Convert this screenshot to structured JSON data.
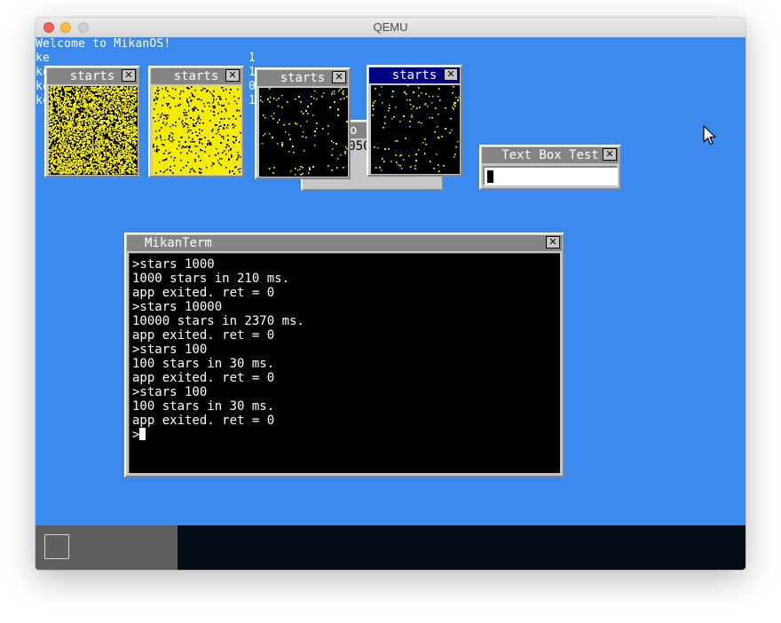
{
  "app": {
    "title": "QEMU"
  },
  "console": {
    "line1": "Welcome to MikanOS!",
    "lines": [
      "ke",
      "ke",
      "ke",
      "ke"
    ],
    "right_digits": [
      "1",
      "1",
      "0",
      "1"
    ]
  },
  "star_windows": [
    {
      "title": "starts",
      "close": "✕",
      "background": "#000000",
      "star_color": "#f6ec00",
      "density": 0.35
    },
    {
      "title": "starts",
      "close": "✕",
      "background": "#f6ec00",
      "star_color": "#000000",
      "density": 0.04
    },
    {
      "title": "starts",
      "close": "✕",
      "background": "#000000",
      "star_color": "#f6ec00",
      "density": 0.012
    },
    {
      "title": "starts",
      "close": "✕",
      "background": "#000000",
      "star_color": "#f6ec00",
      "density": 0.012,
      "active": true
    }
  ],
  "hidden_window": {
    "title_visible": "o",
    "counter_visible": "000050"
  },
  "textbox_window": {
    "title": "Text Box Test",
    "close": "✕",
    "value": ""
  },
  "terminal": {
    "title": "MikanTerm",
    "close": "✕",
    "lines": [
      ">stars 1000",
      "1000 stars in 210 ms.",
      "app exited. ret = 0",
      ">stars 10000",
      "10000 stars in 2370 ms.",
      "app exited. ret = 0",
      ">stars 100",
      "100 stars in 30 ms.",
      "app exited. ret = 0",
      ">stars 100",
      "100 stars in 30 ms.",
      "app exited. ret = 0"
    ],
    "prompt": ">"
  },
  "colors": {
    "desktop": "#3a8aee",
    "taskbar": "#050b17",
    "taskbar_left": "#5f5f5f",
    "window_gray": "#c6c6c6",
    "active_title": "#000084",
    "inactive_title": "#848484"
  },
  "icons": {
    "close": "close-icon",
    "start": "start-button-icon",
    "cursor": "mouse-cursor-icon"
  }
}
